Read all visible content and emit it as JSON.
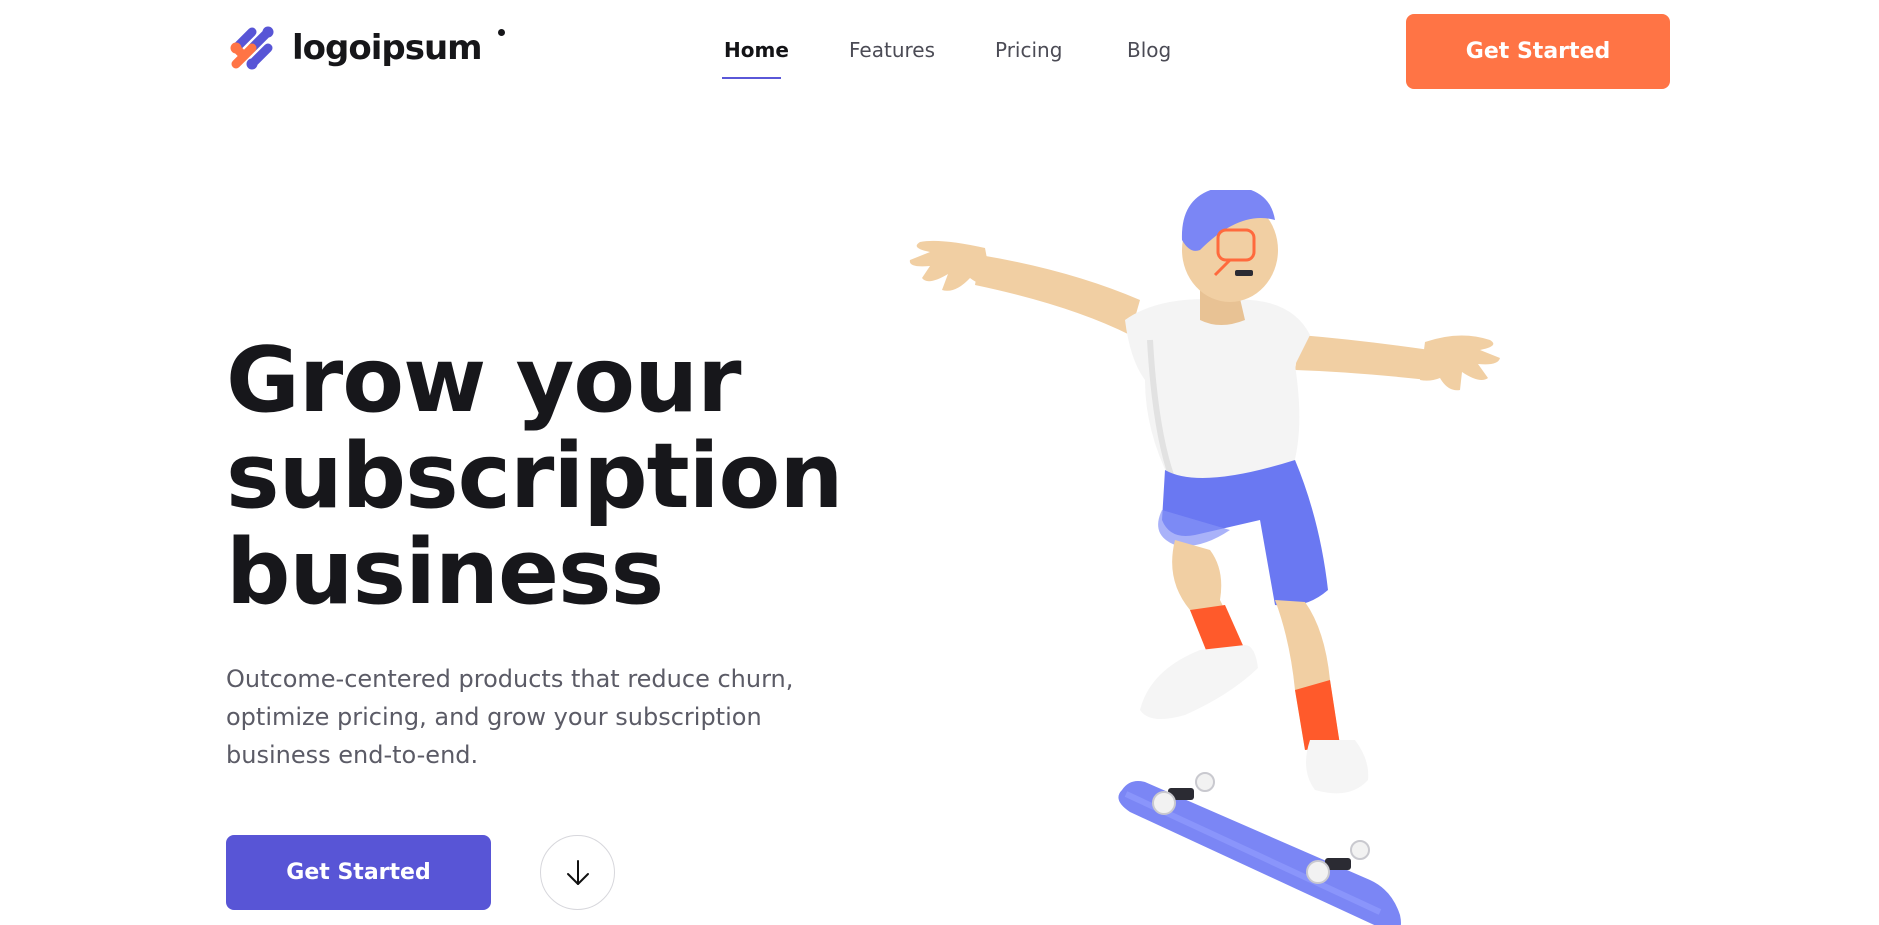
{
  "header": {
    "logo_text": "logoipsum",
    "nav": [
      {
        "label": "Home",
        "active": true
      },
      {
        "label": "Features",
        "active": false
      },
      {
        "label": "Pricing",
        "active": false
      },
      {
        "label": "Blog",
        "active": false
      }
    ],
    "cta_label": "Get Started"
  },
  "hero": {
    "title_lines": [
      "Grow your",
      "subscription",
      "business"
    ],
    "subtitle_lines": [
      "Outcome-centered products that reduce churn,",
      "optimize pricing, and grow your subscription",
      "business end-to-end."
    ],
    "primary_cta_label": "Get Started",
    "scroll_icon": "arrow-down-icon",
    "illustration": "skateboarder-illustration"
  },
  "colors": {
    "accent_orange": "#ff7445",
    "accent_purple": "#5855d6",
    "heading": "#17171b",
    "body_text": "#5b5b66"
  }
}
